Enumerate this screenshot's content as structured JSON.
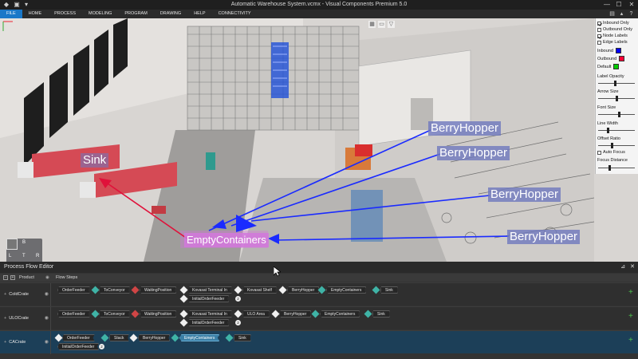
{
  "titlebar": {
    "title": "Automatic Warehouse System.vcmx - Visual Components Premium 5.0",
    "minimize": "—",
    "maximize": "☐",
    "close": "✕"
  },
  "menu": [
    "FILE",
    "HOME",
    "PROCESS",
    "MODELING",
    "PROGRAM",
    "DRAWING",
    "HELP",
    "CONNECTIVITY"
  ],
  "viewport": {
    "labels": {
      "berry_1": "BerryHopper",
      "berry_2": "BerryHopper",
      "berry_3": "BerryHopper",
      "berry_4": "BerryHopper",
      "sink": "Sink",
      "empty": "EmptyContainers"
    },
    "colors": {
      "inbound_arrow": "#1a2bff",
      "outbound_arrow": "#e0113a"
    },
    "navcube": {
      "top": "B",
      "left": "L",
      "center": "T",
      "right": "R",
      "bottom": "F"
    }
  },
  "options_panel": {
    "checkboxes": [
      {
        "label": "Inbound Only",
        "checked": true
      },
      {
        "label": "Outbound Only",
        "checked": false
      },
      {
        "label": "Node Labels",
        "checked": true
      },
      {
        "label": "Edge Labels",
        "checked": false
      }
    ],
    "swatches": [
      {
        "label": "Inbound",
        "color": "#0000ff"
      },
      {
        "label": "Outbound",
        "color": "#ff0033"
      },
      {
        "label": "Default",
        "color": "#00cc00"
      }
    ],
    "sliders": [
      {
        "label": "Label Opacity",
        "value": 0.45
      },
      {
        "label": "Arrow Size",
        "value": 0.5
      },
      {
        "label": "Font Size",
        "value": 0.55
      },
      {
        "label": "Line Width",
        "value": 0.25
      },
      {
        "label": "Offset Ratio",
        "value": 0.35
      }
    ],
    "auto_focus": {
      "label": "Auto Focus",
      "checked": false
    },
    "focus_distance": {
      "label": "Focus Distance",
      "value": 0.3
    }
  },
  "pfe": {
    "title": "Process Flow Editor",
    "col_product": "Product",
    "col_steps": "Flow Steps",
    "rows": [
      {
        "product": "ColdCrate",
        "steps": [
          "OrderFeeder",
          "ToConveyor",
          "WaitingPosition",
          "Kovasat Terminal In",
          "Kovasat Shelf",
          "BerryHopper",
          "EmptyContainers",
          "Sink"
        ],
        "steps2": [
          "InitialOrderFeeder"
        ]
      },
      {
        "product": "ULOCrate",
        "steps": [
          "OrderFeeder",
          "ToConveyor",
          "WaitingPosition",
          "Kovasat Terminal In",
          "ULO Area",
          "BerryHopper",
          "EmptyContainers",
          "Sink"
        ],
        "steps2": [
          "InitialOrderFeeder"
        ]
      },
      {
        "product": "CACrate",
        "steps": [
          "OrderFeeder",
          "Stack",
          "BerryHopper",
          "EmptyContainers",
          "Sink"
        ],
        "steps2": [
          "InitialOrderFeeder"
        ]
      }
    ],
    "badge": "2",
    "add": "+"
  }
}
